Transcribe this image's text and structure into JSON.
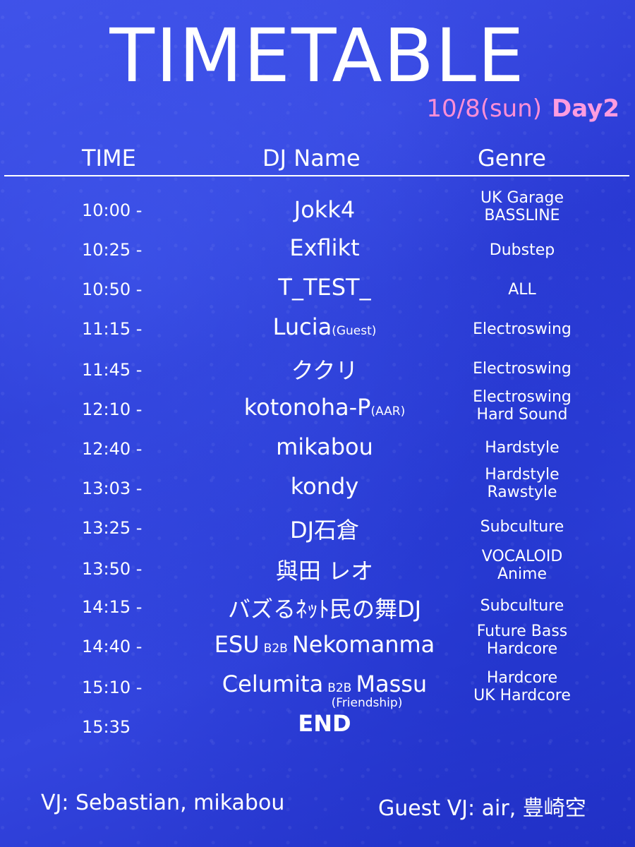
{
  "title": "TIMETABLE",
  "date": "10/8(sun)",
  "day": "Day2",
  "headers": {
    "time": "TIME",
    "dj": "DJ Name",
    "genre": "Genre"
  },
  "rows": [
    {
      "time": "10:00 -",
      "dj": "Jokk4",
      "genre1": "UK Garage",
      "genre2": "BASSLINE"
    },
    {
      "time": "10:25 -",
      "dj": "Exflikt",
      "genre1": "Dubstep",
      "genre2": ""
    },
    {
      "time": "10:50 -",
      "dj": "T_TEST_",
      "genre1": "ALL",
      "genre2": ""
    },
    {
      "time": "11:15 -",
      "dj": "Lucia",
      "dj_note": "(Guest)",
      "genre1": "Electroswing",
      "genre2": ""
    },
    {
      "time": "11:45 -",
      "dj": "ククリ",
      "genre1": "Electroswing",
      "genre2": ""
    },
    {
      "time": "12:10 -",
      "dj": "kotonoha-P",
      "dj_note": "(AAR)",
      "genre1": "Electroswing",
      "genre2": "Hard Sound"
    },
    {
      "time": "12:40 -",
      "dj": "mikabou",
      "genre1": "Hardstyle",
      "genre2": ""
    },
    {
      "time": "13:03 -",
      "dj": "kondy",
      "genre1": "Hardstyle",
      "genre2": "Rawstyle"
    },
    {
      "time": "13:25 -",
      "dj": "DJ石倉",
      "genre1": "Subculture",
      "genre2": ""
    },
    {
      "time": "13:50 -",
      "dj": "與田 レオ",
      "genre1": "VOCALOID",
      "genre2": "Anime"
    },
    {
      "time": "14:15 -",
      "dj": "バズるﾈｯﾄ民の舞DJ",
      "genre1": "Subculture",
      "genre2": ""
    },
    {
      "time": "14:40 -",
      "dj": "ESU",
      "b2b": "B2B",
      "dj_b": "Nekomanma",
      "genre1": "Future Bass",
      "genre2": "Hardcore"
    },
    {
      "time": "15:10 -",
      "dj": "Celumita",
      "b2b": "B2B",
      "dj_b": "Massu",
      "dj_sub": "(Friendship)",
      "genre1": "Hardcore",
      "genre2": "UK Hardcore"
    }
  ],
  "end": {
    "time": "15:35",
    "label": "END"
  },
  "footer": {
    "vj": "VJ: Sebastian, mikabou",
    "guest_vj": "Guest VJ: air, 豊崎空"
  }
}
